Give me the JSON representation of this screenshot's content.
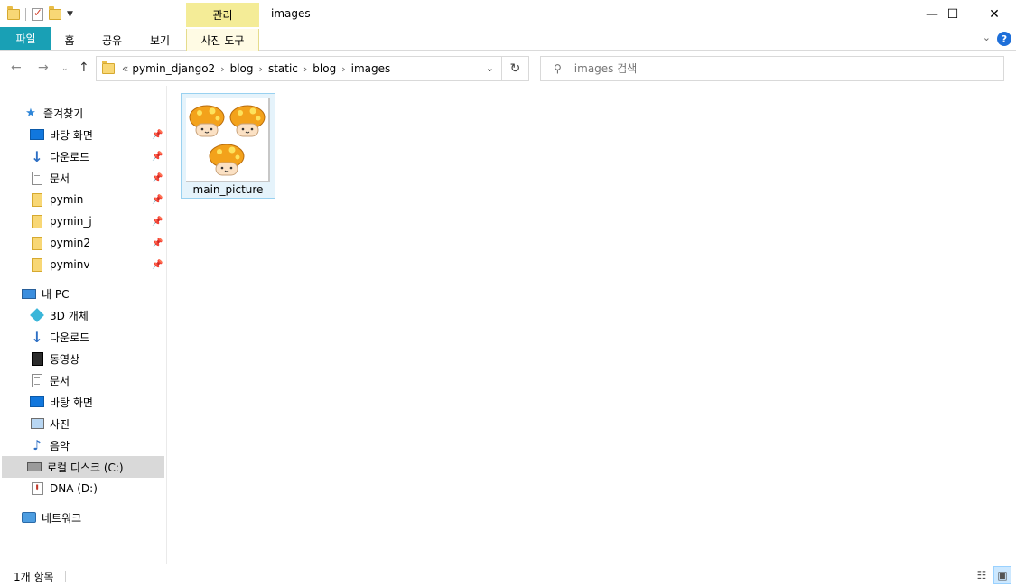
{
  "window": {
    "title": "images",
    "context_tab_header": "관리",
    "minimize": "—",
    "maximize": "☐",
    "close": "✕"
  },
  "ribbon": {
    "tabs": [
      "파일",
      "홈",
      "공유",
      "보기",
      "사진 도구"
    ]
  },
  "address": {
    "prefix": "«",
    "crumbs": [
      "pymin_django2",
      "blog",
      "static",
      "blog",
      "images"
    ],
    "separator": "›",
    "search_placeholder": "images 검색"
  },
  "navpane": {
    "quick_access": "즐겨찾기",
    "quick_items": [
      "바탕 화면",
      "다운로드",
      "문서",
      "pymin",
      "pymin_j",
      "pymin2",
      "pyminv"
    ],
    "this_pc": "내 PC",
    "pc_items": [
      "3D 개체",
      "다운로드",
      "동영상",
      "문서",
      "바탕 화면",
      "사진",
      "음악",
      "로컬 디스크 (C:)",
      "DNA (D:)"
    ],
    "network": "네트워크"
  },
  "files": [
    {
      "name": "main_picture",
      "selected": true
    }
  ],
  "status": {
    "item_count": "1개 항목"
  },
  "colors": {
    "file_tab": "#19a0b5",
    "context_tab": "#f4ec97",
    "selection": "#e5f3fb",
    "selection_border": "#99d1f0"
  }
}
